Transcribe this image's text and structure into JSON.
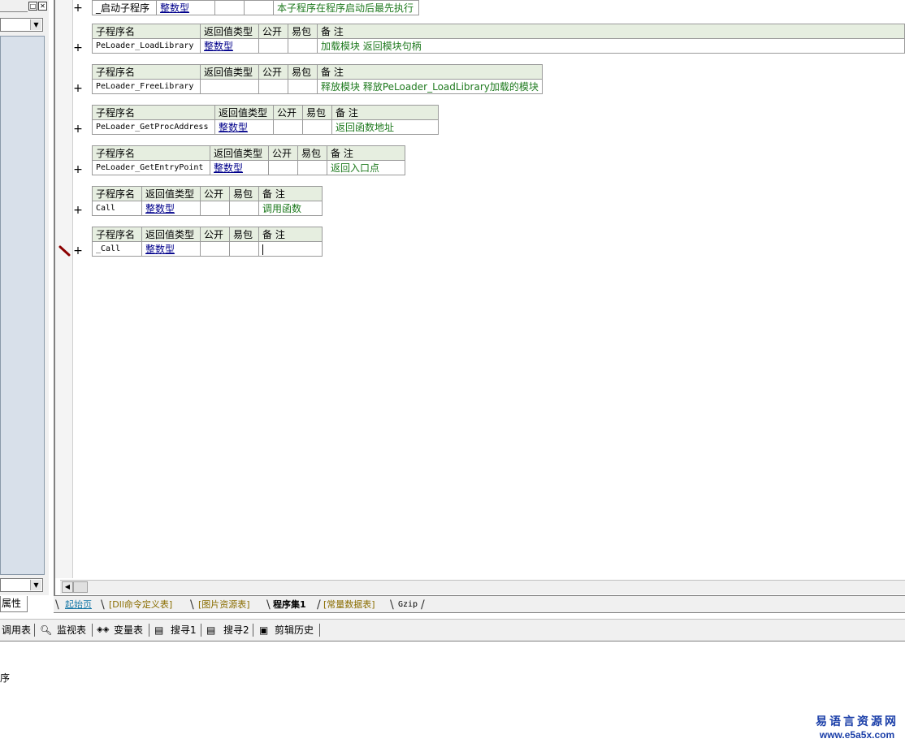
{
  "left_panel": {
    "bottom_tab": "属性"
  },
  "subroutines": [
    {
      "name": "_启动子程序",
      "ret": "整数型",
      "pub": "",
      "easy": "",
      "note": "本子程序在程序启动后最先执行",
      "header": false
    },
    {
      "name": "PeLoader_LoadLibrary",
      "ret": "整数型",
      "pub": "",
      "easy": "",
      "note": "加载模块 返回模块句柄",
      "header": true
    },
    {
      "name": "PeLoader_FreeLibrary",
      "ret": "",
      "pub": "",
      "easy": "",
      "note": "释放模块 释放PeLoader_LoadLibrary加载的模块",
      "header": true
    },
    {
      "name": "PeLoader_GetProcAddress",
      "ret": "整数型",
      "pub": "",
      "easy": "",
      "note": "返回函数地址",
      "header": true
    },
    {
      "name": "PeLoader_GetEntryPoint",
      "ret": "整数型",
      "pub": "",
      "easy": "",
      "note": "返回入口点",
      "header": true
    },
    {
      "name": "Call",
      "ret": "整数型",
      "pub": "",
      "easy": "",
      "note": "调用函数",
      "header": true
    },
    {
      "name": "_Call",
      "ret": "整数型",
      "pub": "",
      "easy": "",
      "note": "",
      "header": true
    }
  ],
  "table_headers": {
    "name": "子程序名",
    "ret": "返回值类型",
    "pub": "公开",
    "easy": "易包",
    "note": "备 注"
  },
  "expand_symbol": "+",
  "tabs": [
    "起始页",
    "[Dll命令定义表]",
    "[图片资源表]",
    "程序集1",
    "[常量数据表]",
    "Gzip"
  ],
  "active_tab": "程序集1",
  "bottom_toolbar": [
    "调用表",
    "监视表",
    "变量表",
    "搜寻1",
    "搜寻2",
    "剪辑历史"
  ],
  "output_text": "序",
  "watermark": {
    "line1": "易语言资源网",
    "line2": "www.e5a5x.com"
  }
}
